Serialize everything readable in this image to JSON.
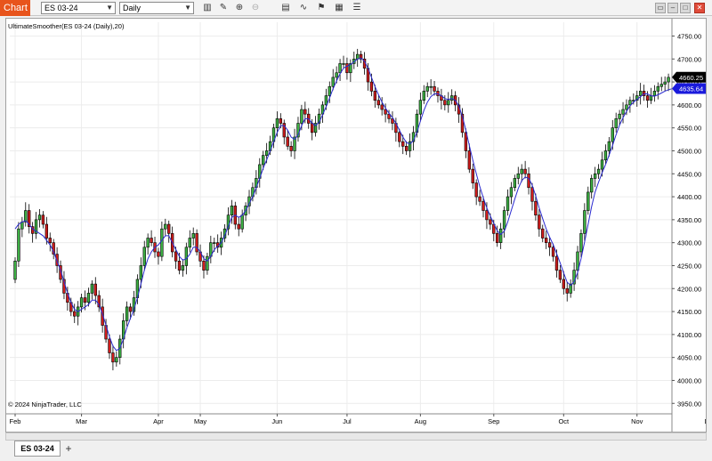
{
  "window": {
    "title_tag": "Chart",
    "instrument": "ES 03-24",
    "interval": "Daily",
    "tab_label": "ES 03-24",
    "add_tab": "+"
  },
  "toolbar_icons": [
    "bar-style-icon",
    "draw-icon",
    "zoom-in-icon",
    "zoom-out-icon",
    "properties-icon",
    "indicators-icon",
    "strategy-icon",
    "chart-trader-icon",
    "template-icon"
  ],
  "colors": {
    "up": "#3cb043",
    "down": "#d01c1c",
    "indicator": "#2b2bd0",
    "last_price_bg": "#000000",
    "indicator_price_bg": "#1a1adc",
    "accent": "#e8541c"
  },
  "chart_data": {
    "type": "candlestick",
    "indicator_label": "UltimateSmoother(ES 03-24 (Daily),20)",
    "copyright": "© 2024 NinjaTrader, LLC",
    "last_price": "4660.25",
    "indicator_value": "4635.64",
    "ylim": [
      3935,
      4780
    ],
    "y_ticks": [
      "4750.00",
      "4700.00",
      "4650.00",
      "4600.00",
      "4550.00",
      "4500.00",
      "4450.00",
      "4400.00",
      "4350.00",
      "4300.00",
      "4250.00",
      "4200.00",
      "4150.00",
      "4100.00",
      "4050.00",
      "4000.00",
      "3950.00"
    ],
    "x_labels": [
      "Feb",
      "Mar",
      "Apr",
      "May",
      "Jun",
      "Jul",
      "Aug",
      "Sep",
      "Oct",
      "Nov",
      "Dec"
    ],
    "x_label_bar_index": [
      0,
      19,
      41,
      53,
      75,
      95,
      116,
      137,
      157,
      178,
      199
    ],
    "closes": [
      4260,
      4330,
      4345,
      4370,
      4335,
      4320,
      4350,
      4360,
      4340,
      4310,
      4300,
      4275,
      4250,
      4220,
      4190,
      4170,
      4150,
      4140,
      4160,
      4180,
      4170,
      4190,
      4210,
      4185,
      4160,
      4120,
      4090,
      4060,
      4040,
      4050,
      4090,
      4130,
      4160,
      4150,
      4180,
      4220,
      4250,
      4290,
      4310,
      4300,
      4280,
      4270,
      4330,
      4340,
      4320,
      4280,
      4260,
      4240,
      4250,
      4290,
      4310,
      4320,
      4280,
      4260,
      4240,
      4270,
      4300,
      4300,
      4290,
      4310,
      4330,
      4360,
      4380,
      4340,
      4330,
      4360,
      4380,
      4400,
      4420,
      4440,
      4470,
      4490,
      4500,
      4520,
      4550,
      4570,
      4560,
      4530,
      4510,
      4500,
      4530,
      4560,
      4590,
      4580,
      4560,
      4540,
      4560,
      4580,
      4600,
      4620,
      4640,
      4660,
      4670,
      4690,
      4690,
      4670,
      4690,
      4700,
      4710,
      4700,
      4680,
      4650,
      4630,
      4610,
      4600,
      4590,
      4580,
      4570,
      4560,
      4540,
      4520,
      4510,
      4500,
      4520,
      4540,
      4580,
      4610,
      4630,
      4640,
      4640,
      4630,
      4620,
      4610,
      4600,
      4610,
      4620,
      4600,
      4580,
      4540,
      4500,
      4460,
      4430,
      4400,
      4390,
      4370,
      4350,
      4340,
      4320,
      4300,
      4330,
      4370,
      4400,
      4420,
      4440,
      4450,
      4460,
      4450,
      4420,
      4390,
      4360,
      4330,
      4310,
      4300,
      4290,
      4270,
      4240,
      4220,
      4200,
      4190,
      4210,
      4240,
      4280,
      4320,
      4370,
      4410,
      4440,
      4450,
      4460,
      4480,
      4500,
      4520,
      4550,
      4570,
      4580,
      4590,
      4600,
      4610,
      4610,
      4620,
      4630,
      4620,
      4610,
      4620,
      4630,
      4640,
      4645,
      4650,
      4660
    ],
    "indicator": [
      4330,
      4340,
      4345,
      4348,
      4340,
      4330,
      4325,
      4320,
      4315,
      4305,
      4295,
      4280,
      4260,
      4240,
      4215,
      4190,
      4170,
      4155,
      4150,
      4155,
      4160,
      4165,
      4175,
      4175,
      4165,
      4145,
      4120,
      4095,
      4075,
      4065,
      4070,
      4090,
      4115,
      4135,
      4155,
      4180,
      4210,
      4240,
      4265,
      4280,
      4290,
      4295,
      4305,
      4315,
      4315,
      4300,
      4285,
      4270,
      4262,
      4265,
      4275,
      4290,
      4290,
      4280,
      4265,
      4260,
      4270,
      4285,
      4292,
      4300,
      4315,
      4335,
      4355,
      4360,
      4355,
      4360,
      4370,
      4385,
      4400,
      4420,
      4440,
      4462,
      4480,
      4500,
      4520,
      4540,
      4555,
      4555,
      4545,
      4530,
      4525,
      4535,
      4555,
      4570,
      4570,
      4560,
      4555,
      4562,
      4578,
      4596,
      4615,
      4635,
      4652,
      4668,
      4680,
      4684,
      4688,
      4694,
      4700,
      4702,
      4695,
      4680,
      4660,
      4640,
      4622,
      4606,
      4593,
      4582,
      4572,
      4560,
      4545,
      4530,
      4518,
      4515,
      4522,
      4540,
      4565,
      4588,
      4606,
      4618,
      4624,
      4624,
      4620,
      4614,
      4612,
      4614,
      4610,
      4598,
      4575,
      4545,
      4512,
      4480,
      4450,
      4422,
      4398,
      4376,
      4358,
      4342,
      4326,
      4318,
      4325,
      4345,
      4370,
      4395,
      4418,
      4435,
      4443,
      4440,
      4425,
      4402,
      4376,
      4352,
      4330,
      4312,
      4296,
      4276,
      4256,
      4234,
      4214,
      4207,
      4215,
      4235,
      4265,
      4302,
      4340,
      4378,
      4410,
      4432,
      4452,
      4470,
      4490,
      4512,
      4535,
      4556,
      4572,
      4586,
      4598,
      4606,
      4612,
      4618,
      4624,
      4624,
      4620,
      4619,
      4622,
      4626,
      4630,
      4633,
      4635,
      4635.64
    ]
  }
}
